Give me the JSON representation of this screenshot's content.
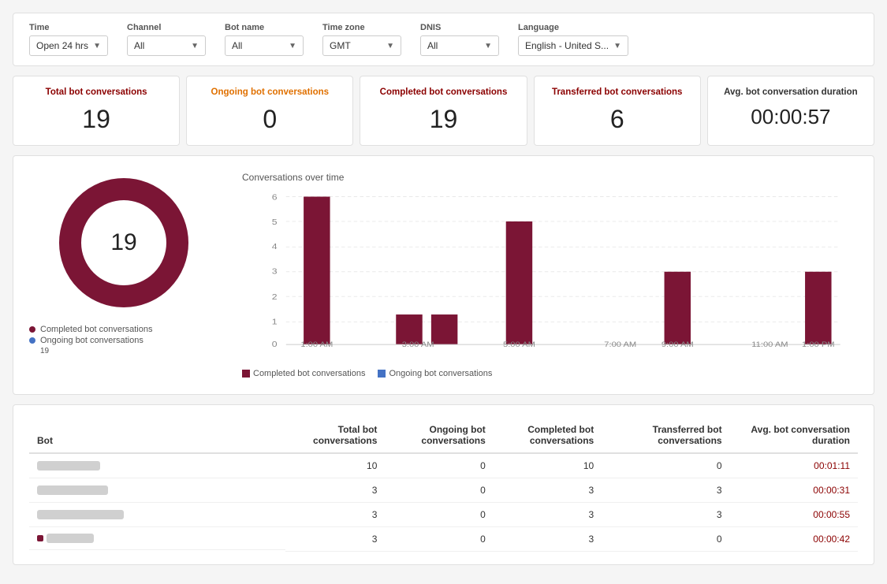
{
  "filters": {
    "time_label": "Time",
    "time_value": "Open 24 hrs",
    "channel_label": "Channel",
    "channel_value": "All",
    "botname_label": "Bot name",
    "botname_value": "All",
    "timezone_label": "Time zone",
    "timezone_value": "GMT",
    "dnis_label": "DNIS",
    "dnis_value": "All",
    "language_label": "Language",
    "language_value": "English - United S..."
  },
  "stats": {
    "total_label": "Total bot conversations",
    "total_value": "19",
    "ongoing_label": "Ongoing bot conversations",
    "ongoing_value": "0",
    "completed_label": "Completed bot conversations",
    "completed_value": "19",
    "transferred_label": "Transferred bot conversations",
    "transferred_value": "6",
    "avg_label": "Avg. bot conversation duration",
    "avg_value": "00:00:57"
  },
  "donut": {
    "center_value": "19",
    "small_label": "19",
    "completed_label": "Completed bot conversations",
    "ongoing_label": "Ongoing bot conversations"
  },
  "bar_chart": {
    "title": "Conversations over time",
    "y_max": 6,
    "y_labels": [
      "6",
      "4",
      "2",
      "0"
    ],
    "x_labels": [
      "1:00 AM",
      "3:00 AM",
      "5:00 AM",
      "7:00 AM",
      "9:00 AM",
      "11:00 AM",
      "1:00 PM"
    ],
    "bars": [
      {
        "x_label": "1:00 AM",
        "height": 6
      },
      {
        "x_label": "3:00 AM",
        "height": 1.2
      },
      {
        "x_label": "3:30 AM",
        "height": 1.2
      },
      {
        "x_label": "5:00 AM",
        "height": 5
      },
      {
        "x_label": "9:00 AM",
        "height": 3
      },
      {
        "x_label": "1:00 PM",
        "height": 3
      }
    ],
    "completed_label": "Completed bot conversations",
    "ongoing_label": "Ongoing bot conversations"
  },
  "table": {
    "col_bot": "Bot",
    "col_total": "Total bot conversations",
    "col_ongoing": "Ongoing bot conversations",
    "col_completed": "Completed bot conversations",
    "col_transferred": "Transferred bot conversations",
    "col_avg": "Avg. bot conversation duration",
    "rows": [
      {
        "bot_width": 80,
        "total": "10",
        "ongoing": "0",
        "completed": "10",
        "transferred": "0",
        "avg": "00:01:11"
      },
      {
        "bot_width": 90,
        "total": "3",
        "ongoing": "0",
        "completed": "3",
        "transferred": "3",
        "avg": "00:00:31"
      },
      {
        "bot_width": 110,
        "total": "3",
        "ongoing": "0",
        "completed": "3",
        "transferred": "3",
        "avg": "00:00:55"
      },
      {
        "bot_width": 70,
        "total": "3",
        "ongoing": "0",
        "completed": "3",
        "transferred": "0",
        "avg": "00:00:42"
      }
    ]
  }
}
